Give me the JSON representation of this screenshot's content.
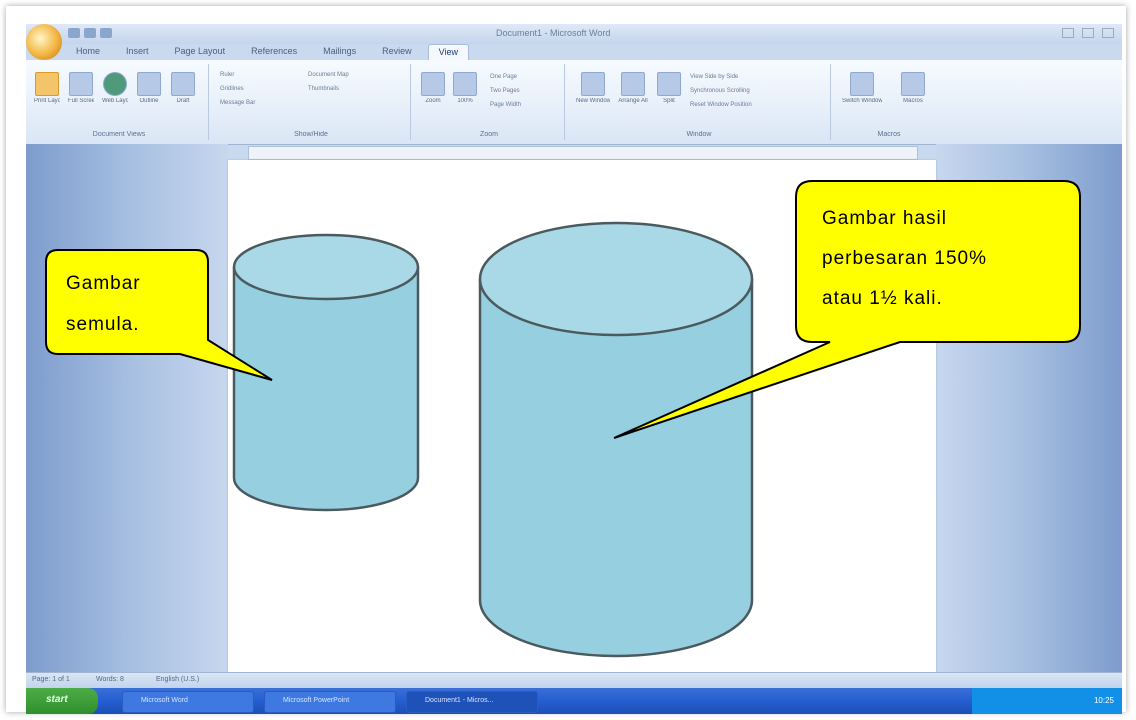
{
  "window": {
    "title": "Document1 - Microsoft Word",
    "quick_access_icons": [
      "save-icon",
      "undo-icon",
      "redo-icon"
    ]
  },
  "ribbon": {
    "tabs": [
      "Home",
      "Insert",
      "Page Layout",
      "References",
      "Mailings",
      "Review",
      "View"
    ],
    "active_tab": "View",
    "groups": [
      {
        "label": "Document Views",
        "buttons": [
          "Print Layout",
          "Full Screen Reading",
          "Web Layout",
          "Outline",
          "Draft"
        ]
      },
      {
        "label": "Show/Hide",
        "items": [
          "Ruler",
          "Gridlines",
          "Message Bar",
          "Document Map",
          "Thumbnails"
        ]
      },
      {
        "label": "Zoom",
        "buttons": [
          "Zoom",
          "100%"
        ],
        "items": [
          "One Page",
          "Two Pages",
          "Page Width"
        ]
      },
      {
        "label": "Window",
        "buttons": [
          "New Window",
          "Arrange All",
          "Split"
        ],
        "items": [
          "View Side by Side",
          "Synchronous Scrolling",
          "Reset Window Position"
        ]
      },
      {
        "label": "Macros",
        "buttons": [
          "Switch Windows",
          "Macros"
        ]
      }
    ]
  },
  "status_bar": {
    "page": "Page: 1 of 1",
    "words": "Words: 8",
    "language": "English (U.S.)"
  },
  "taskbar": {
    "start_label": "start",
    "items": [
      "Microsoft Word",
      "Microsoft PowerPoint",
      "Document1 - Micros..."
    ],
    "clock": "10:25"
  },
  "document": {
    "callout_left": {
      "lines": [
        "Gambar",
        "semula."
      ]
    },
    "callout_right": {
      "lines": [
        "Gambar hasil",
        "perbesaran 150%",
        "atau 1½ kali."
      ]
    },
    "shape_fill": "#95cfe0",
    "callout_fill": "#ffff00"
  }
}
